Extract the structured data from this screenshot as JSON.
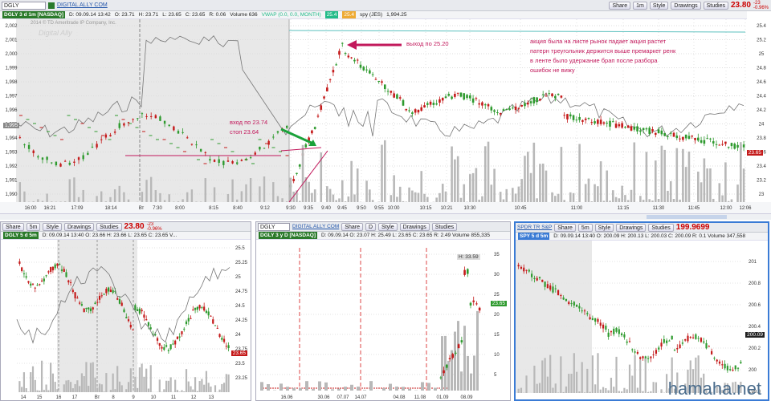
{
  "symbol": "DGLY",
  "main_symbol": "DGLY 3 d 1m [NASDAQ]",
  "company": "DIGITAL ALLY COM",
  "toolbar": {
    "share": "Share",
    "interval": "1m",
    "style": "Style",
    "drawings": "Drawings",
    "studies": "Studies"
  },
  "main_price": "23.80",
  "main_change": "-23 -0.96%",
  "quote": {
    "date": "D: 09.09.14 13:42",
    "open": "O: 23.71",
    "high": "H: 23.71",
    "low": "L: 23.65",
    "close": "C: 23.65",
    "range": "R: 0.06",
    "volume": "Volume 636",
    "vwap": "VWAP (0.0, 0.0, MONTH)",
    "v1": "25.4",
    "v2": "25.4",
    "spy": "spy (JES)",
    "spy_val": "1,994.25"
  },
  "watermark": "2014 © TD Ameritrade IP Company, Inc.",
  "watermark_logo": "Digital Ally",
  "annotations": {
    "entry": "вход по 23.74",
    "stop": "стоп 23.64",
    "exit": "выход по 25.20",
    "comment": [
      "акция была на листе рынок падает акция растет",
      "патерн треугольник держится выше премаркет ренк",
      "в ленте было удержание брап после разбора",
      "ошибок не вижу"
    ]
  },
  "main_y": [
    "25.4",
    "25.2",
    "25",
    "24.8",
    "24.6",
    "24.4",
    "24.2",
    "24",
    "23.8",
    "23.6",
    "23.4",
    "23.2",
    "23"
  ],
  "main_ly": [
    "2,002",
    "2,001",
    "2,000",
    "1,999",
    "1,998",
    "1,997",
    "1,996",
    "1,995",
    "1,994",
    "1,993",
    "1,992",
    "1,991",
    "1,990"
  ],
  "main_x": [
    "16:00",
    "16:21",
    "17:09",
    "18:14",
    "Вт",
    "7:30",
    "8:00",
    "8:15",
    "8:40",
    "9:12",
    "9:30",
    "9:35",
    "9:40",
    "9:45",
    "9:50",
    "9:55",
    "10:00",
    "10:15",
    "10:21",
    "10:30",
    "10:45",
    "11:00",
    "11:15",
    "11:30",
    "11:45",
    "12:00",
    "12:06"
  ],
  "main_price_tag": "23.65",
  "main_left_tag": "1,995",
  "p1": {
    "sym": "DGLY 5 d 5m",
    "price": "23.80",
    "change": "-23 -0.96%",
    "quote": "D: 09.09.14 13:40  O: 23.66  H: 23.66  L: 23.65  C: 23.65  V...",
    "interval": "5m",
    "y": [
      "25.5",
      "25.25",
      "25",
      "24.75",
      "24.5",
      "24.25",
      "24",
      "23.75",
      "23.5",
      "23.25"
    ],
    "x": [
      "14",
      "15",
      "16",
      "17",
      "Вт",
      "8",
      "9",
      "10",
      "11",
      "12",
      "13"
    ],
    "tag": "23.65"
  },
  "p2": {
    "sym": "DGLY 3 y D [NASDAQ]",
    "company": "DIGITAL ALLY COM",
    "price": "23.80",
    "change": "-23 -0.96%",
    "quote": "D: 09.09.14  O: 23.07  H: 25.49  L: 23.65  C: 23.65  R: 2.49  Volume 855,335",
    "interval": "D",
    "y": [
      "35",
      "30",
      "25",
      "20",
      "15",
      "10",
      "5"
    ],
    "x": [
      "16.06",
      "30.06",
      "07.07",
      "14.07",
      "04.08",
      "11.08",
      "01.09",
      "08.09"
    ],
    "hi": "H: 33.59",
    "tag": "23.65"
  },
  "p3": {
    "sym": "SPY 5 d 5m",
    "company": "SPDR TR S&P",
    "price": "199.9699",
    "change": "-23 -0.96%",
    "quote": "D: 09.09.14 13:40  O: 200.09  H: 200.13  L: 200.03  C: 200.09  R: 0.1  Volume 347,558",
    "interval": "5m",
    "y": [
      "201",
      "200.8",
      "200.6",
      "200.4",
      "200.2",
      "200",
      "199.8"
    ],
    "tag": "200.09"
  },
  "site": "hamaha.net",
  "colors": {
    "up": "#2e9a2e",
    "down": "#c41a1a",
    "vol": "#b8b8b8",
    "magenta": "#c2185b",
    "green": "#1aa23a",
    "highlight": "#e8e8e8"
  }
}
